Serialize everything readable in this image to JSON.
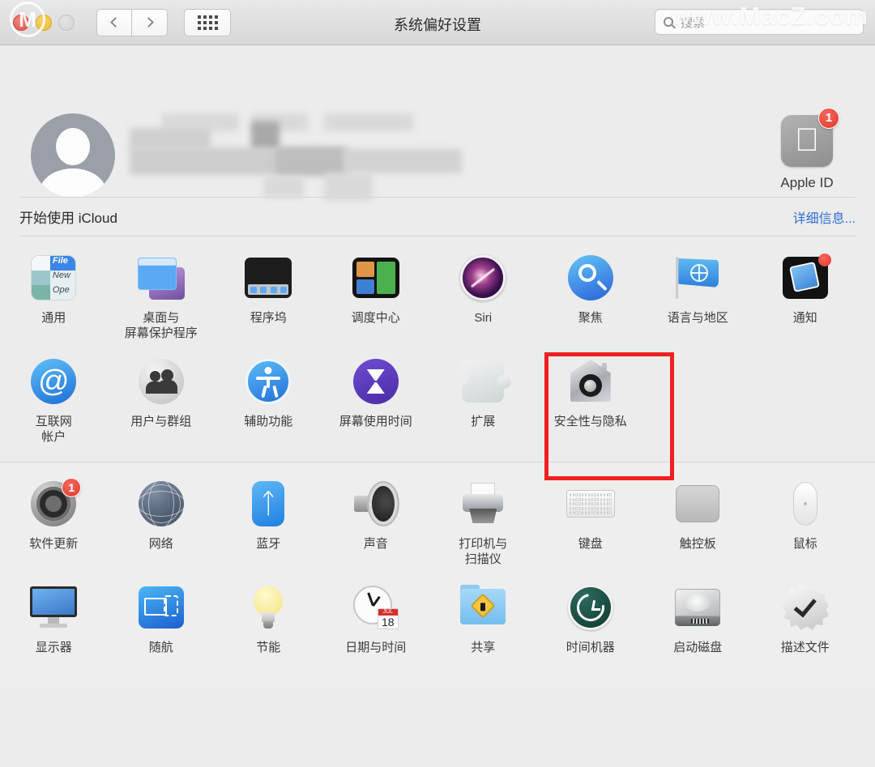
{
  "window": {
    "title": "系统偏好设置",
    "traffic_lights": [
      "close",
      "minimize",
      "zoom"
    ],
    "nav_back": "‹",
    "nav_forward": "›",
    "grid_button": "show-all-grid"
  },
  "search": {
    "placeholder": "搜索",
    "icon": "search-icon"
  },
  "watermark": {
    "text": "www.MacZ.com",
    "logo": "M"
  },
  "account": {
    "avatar": "user-avatar-placeholder",
    "name_redacted": true,
    "apple_id": {
      "label": "Apple ID",
      "badge": "1",
      "icon": "apple-logo-icon"
    }
  },
  "icloud": {
    "text": "开始使用 iCloud",
    "link": "详细信息..."
  },
  "highlight": {
    "target": "安全性与隐私",
    "color": "#ef2020"
  },
  "sections": [
    {
      "id": "section-1",
      "rows": [
        [
          {
            "label": "通用",
            "icon": "general-icon"
          },
          {
            "label": "桌面与\n屏幕保护程序",
            "icon": "desktop-screensaver-icon"
          },
          {
            "label": "程序坞",
            "icon": "dock-icon"
          },
          {
            "label": "调度中心",
            "icon": "mission-control-icon"
          },
          {
            "label": "Siri",
            "icon": "siri-icon"
          },
          {
            "label": "聚焦",
            "icon": "spotlight-icon"
          },
          {
            "label": "语言与地区",
            "icon": "language-region-icon"
          },
          {
            "label": "通知",
            "icon": "notifications-icon"
          }
        ],
        [
          {
            "label": "互联网\n帐户",
            "icon": "internet-accounts-icon"
          },
          {
            "label": "用户与群组",
            "icon": "users-groups-icon"
          },
          {
            "label": "辅助功能",
            "icon": "accessibility-icon"
          },
          {
            "label": "屏幕使用时间",
            "icon": "screen-time-icon"
          },
          {
            "label": "扩展",
            "icon": "extensions-icon"
          },
          {
            "label": "安全性与隐私",
            "icon": "security-privacy-icon"
          },
          {
            "label": "",
            "icon": ""
          },
          {
            "label": "",
            "icon": ""
          }
        ]
      ]
    },
    {
      "id": "section-2",
      "rows": [
        [
          {
            "label": "软件更新",
            "icon": "software-update-icon",
            "badge": "1"
          },
          {
            "label": "网络",
            "icon": "network-icon"
          },
          {
            "label": "蓝牙",
            "icon": "bluetooth-icon"
          },
          {
            "label": "声音",
            "icon": "sound-icon"
          },
          {
            "label": "打印机与\n扫描仪",
            "icon": "printers-scanners-icon"
          },
          {
            "label": "键盘",
            "icon": "keyboard-icon"
          },
          {
            "label": "触控板",
            "icon": "trackpad-icon"
          },
          {
            "label": "鼠标",
            "icon": "mouse-icon"
          }
        ],
        [
          {
            "label": "显示器",
            "icon": "displays-icon"
          },
          {
            "label": "随航",
            "icon": "sidecar-icon"
          },
          {
            "label": "节能",
            "icon": "energy-saver-icon"
          },
          {
            "label": "日期与时间",
            "icon": "date-time-icon",
            "cal_month": "JUL",
            "cal_day": "18"
          },
          {
            "label": "共享",
            "icon": "sharing-icon"
          },
          {
            "label": "时间机器",
            "icon": "time-machine-icon"
          },
          {
            "label": "启动磁盘",
            "icon": "startup-disk-icon"
          },
          {
            "label": "描述文件",
            "icon": "profiles-icon"
          }
        ]
      ]
    }
  ]
}
